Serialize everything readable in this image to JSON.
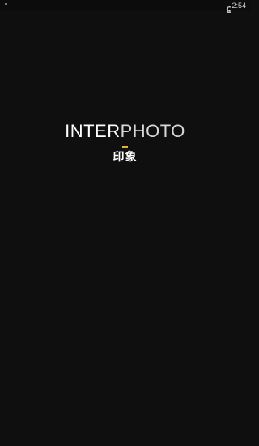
{
  "status_bar": {
    "time": "2:54",
    "left_icon": "notification-dot-icon",
    "battery_icon": "battery-icon"
  },
  "splash": {
    "logo_part_bold": "INTER",
    "logo_part_light": "PHOTO",
    "subtitle": "印象",
    "accent_color": "#e3b23c",
    "background_color": "#0f0f0f"
  }
}
